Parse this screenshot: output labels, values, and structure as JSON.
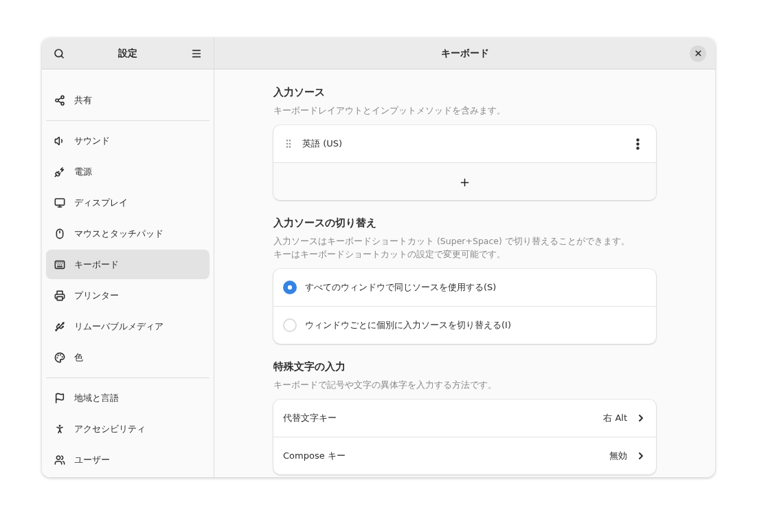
{
  "sidebar": {
    "title": "設定",
    "groups": [
      [
        {
          "label": "共有",
          "selected": false
        }
      ],
      [
        {
          "label": "サウンド",
          "selected": false
        },
        {
          "label": "電源",
          "selected": false
        },
        {
          "label": "ディスプレイ",
          "selected": false
        },
        {
          "label": "マウスとタッチパッド",
          "selected": false
        },
        {
          "label": "キーボード",
          "selected": true
        },
        {
          "label": "プリンター",
          "selected": false
        },
        {
          "label": "リムーバブルメディア",
          "selected": false
        },
        {
          "label": "色",
          "selected": false
        }
      ],
      [
        {
          "label": "地域と言語",
          "selected": false
        },
        {
          "label": "アクセシビリティ",
          "selected": false
        },
        {
          "label": "ユーザー",
          "selected": false
        }
      ]
    ]
  },
  "header": {
    "title": "キーボード"
  },
  "sections": [
    {
      "kind": "sources",
      "title": "入力ソース",
      "description": [
        "キーボードレイアウトとインプットメソッドを含みます。"
      ],
      "items": [
        {
          "label": "英語 (US)"
        }
      ],
      "add_label": "+"
    },
    {
      "kind": "radios",
      "title": "入力ソースの切り替え",
      "description": [
        "入力ソースはキーボードショートカット (Super+Space) で切り替えることができます。",
        "キーはキーボードショートカットの設定で変更可能です。"
      ],
      "items": [
        {
          "label": "すべてのウィンドウで同じソースを使用する(S)",
          "selected": true
        },
        {
          "label": "ウィンドウごとに個別に入力ソースを切り替える(I)",
          "selected": false
        }
      ]
    },
    {
      "kind": "links",
      "title": "特殊文字の入力",
      "description": [
        "キーボードで記号や文字の異体字を入力する方法です。"
      ],
      "items": [
        {
          "label": "代替文字キー",
          "value": "右 Alt"
        },
        {
          "label": "Compose キー",
          "value": "無効"
        }
      ]
    }
  ]
}
